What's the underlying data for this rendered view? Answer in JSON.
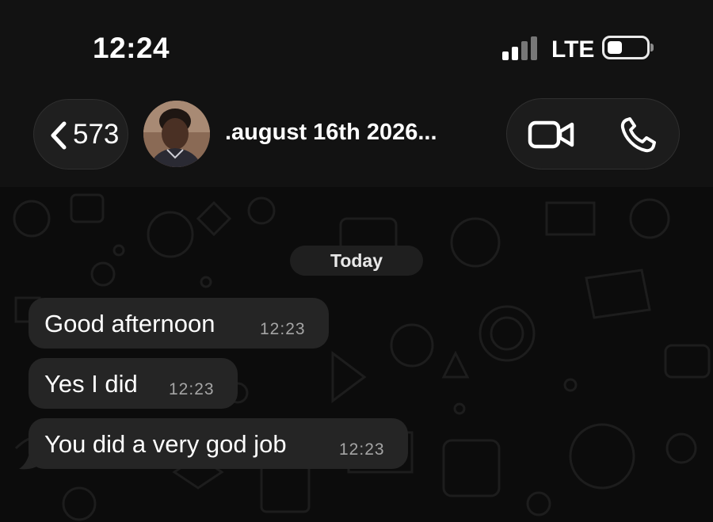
{
  "status_bar": {
    "time": "12:24",
    "network": "LTE"
  },
  "header": {
    "back_count": "573",
    "contact_name": ".august 16th 2026...",
    "icons": [
      "chevron-left-icon",
      "video-camera-icon",
      "phone-icon"
    ]
  },
  "chat": {
    "date_label": "Today",
    "messages": [
      {
        "text": "Good afternoon",
        "time": "12:23"
      },
      {
        "text": "Yes I did",
        "time": "12:23"
      },
      {
        "text": "You did a very god job",
        "time": "12:23"
      }
    ]
  },
  "colors": {
    "header_bg": "#121212",
    "chat_bg": "#0c0c0c",
    "bubble_bg": "#252525",
    "timestamp": "#a5a5a5"
  }
}
